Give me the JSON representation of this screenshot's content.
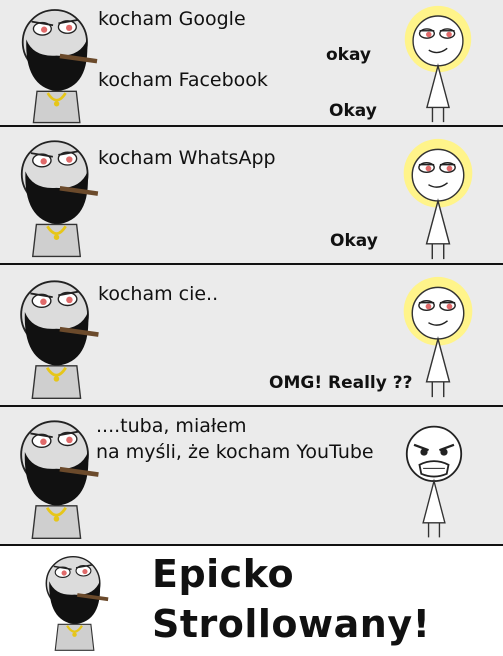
{
  "panels": [
    {
      "man": [
        "kocham Google",
        "kocham Facebook"
      ],
      "woman": [
        "okay",
        "Okay"
      ]
    },
    {
      "man": [
        "kocham WhatsApp"
      ],
      "woman": [
        "Okay"
      ]
    },
    {
      "man": [
        "kocham cie.."
      ],
      "woman": [
        "OMG! Really ??"
      ]
    },
    {
      "man": [
        "....tuba, miałem",
        "na myśli, że kocham YouTube"
      ]
    },
    {
      "caption": [
        "Epicko",
        "Strollowany!"
      ]
    }
  ],
  "colors": {
    "panel_bg": "#ebebeb",
    "beard": "#111111",
    "chain": "#e6c619",
    "woman_hair": "#fff48a",
    "cigar": "#6b4a2b",
    "eye_red": "#e06a6a"
  },
  "icons": [
    "man-rage-face-icon",
    "woman-meme-face-icon",
    "rage-face-icon"
  ]
}
